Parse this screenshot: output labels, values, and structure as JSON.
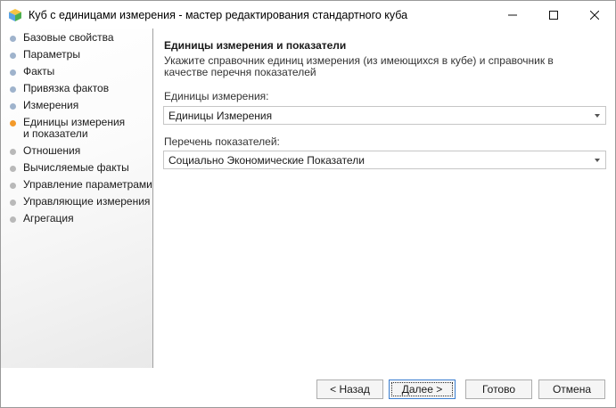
{
  "window": {
    "title": "Куб с единицами измерения - мастер редактирования стандартного куба",
    "icon": "cube-icon"
  },
  "steps": [
    {
      "label": "Базовые свойства",
      "state": "done"
    },
    {
      "label": "Параметры",
      "state": "done"
    },
    {
      "label": "Факты",
      "state": "done"
    },
    {
      "label": "Привязка фактов",
      "state": "done"
    },
    {
      "label": "Измерения",
      "state": "done"
    },
    {
      "label": "Единицы измерения и показатели",
      "state": "active"
    },
    {
      "label": "Отношения",
      "state": "todo"
    },
    {
      "label": "Вычисляемые факты",
      "state": "todo"
    },
    {
      "label": "Управление параметрами",
      "state": "todo"
    },
    {
      "label": "Управляющие измерения",
      "state": "todo"
    },
    {
      "label": "Агрегация",
      "state": "todo"
    }
  ],
  "section": {
    "title": "Единицы измерения и показатели",
    "description": "Укажите справочник единиц измерения  (из имеющихся в кубе) и справочник в качестве перечня показателей"
  },
  "fields": {
    "units_label": "Единицы измерения:",
    "units_value": "Единицы Измерения",
    "indicators_label": "Перечень показателей:",
    "indicators_value": "Социально Экономические Показатели"
  },
  "buttons": {
    "back": "< Назад",
    "next": "Далее >",
    "finish": "Готово",
    "cancel": "Отмена"
  },
  "colors": {
    "active_step": "#f39a2a",
    "done_step": "#9fb3cc",
    "todo_step": "#b9b9b9",
    "default_button_border": "#3c7fd1"
  }
}
